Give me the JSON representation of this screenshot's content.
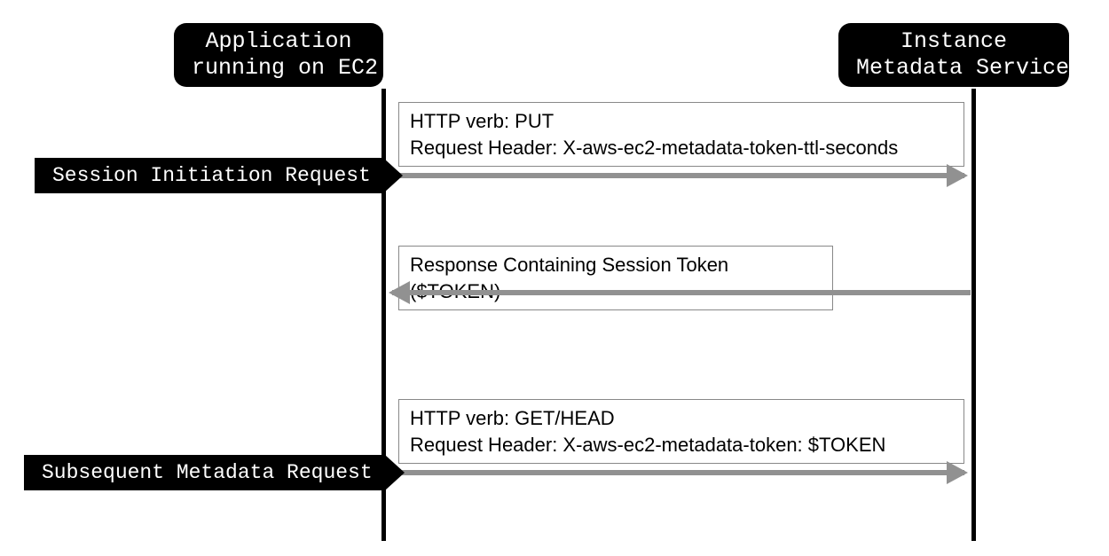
{
  "participants": {
    "left": "Application\nrunning on EC2",
    "right": "Instance\nMetadata Service"
  },
  "side_labels": {
    "initiation": "Session Initiation Request",
    "subsequent": "Subsequent Metadata Request"
  },
  "messages": {
    "put": {
      "line1": "HTTP verb: PUT",
      "line2": "Request Header: X-aws-ec2-metadata-token-ttl-seconds"
    },
    "token_response": "Response Containing Session Token ($TOKEN)",
    "get": {
      "line1": "HTTP verb: GET/HEAD",
      "line2": "Request Header: X-aws-ec2-metadata-token: $TOKEN"
    }
  },
  "chart_data": {
    "type": "sequence",
    "participants": [
      "Application running on EC2",
      "Instance Metadata Service"
    ],
    "messages": [
      {
        "from": "Application running on EC2",
        "to": "Instance Metadata Service",
        "label": "HTTP verb: PUT\nRequest Header: X-aws-ec2-metadata-token-ttl-seconds",
        "note_left": "Session Initiation Request"
      },
      {
        "from": "Instance Metadata Service",
        "to": "Application running on EC2",
        "label": "Response Containing Session Token ($TOKEN)"
      },
      {
        "from": "Application running on EC2",
        "to": "Instance Metadata Service",
        "label": "HTTP verb: GET/HEAD\nRequest Header: X-aws-ec2-metadata-token: $TOKEN",
        "note_left": "Subsequent Metadata Request"
      }
    ]
  }
}
